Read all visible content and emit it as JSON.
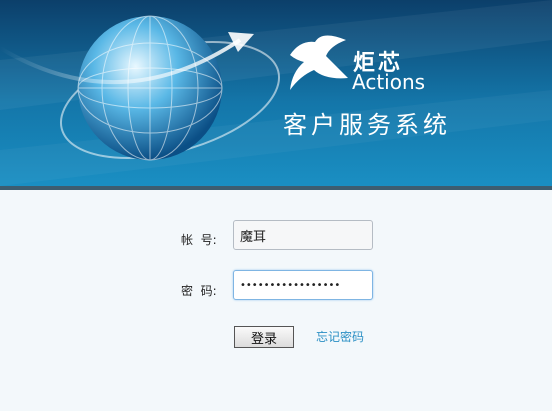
{
  "header": {
    "brand_cn": "炬芯",
    "brand_en": "Actions",
    "system_title": "客户服务系统"
  },
  "form": {
    "account_label": "帐  号:",
    "account_value": "魔耳",
    "password_label": "密  码:",
    "password_value": "•••••••••••••••••",
    "login_label": "登录",
    "forgot_label": "忘记密码"
  },
  "colors": {
    "banner_top": "#0c3f6a",
    "banner_bottom": "#1a8fc3",
    "link": "#2a8fc4",
    "background": "#f3f8fb"
  }
}
